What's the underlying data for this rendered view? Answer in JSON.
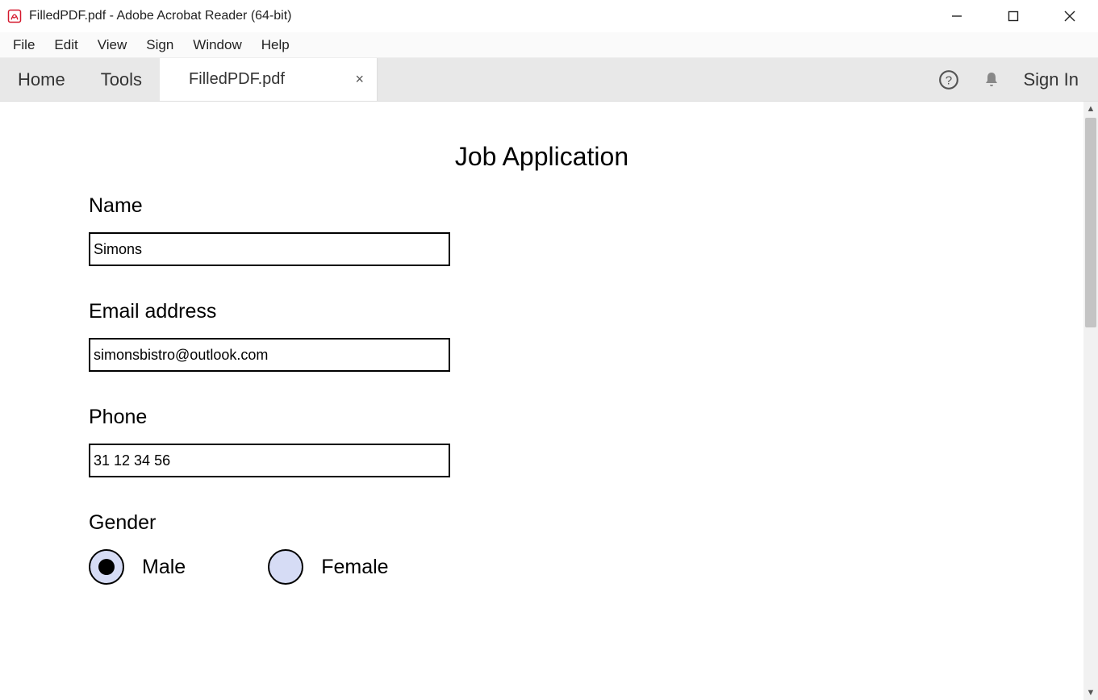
{
  "window": {
    "title": "FilledPDF.pdf - Adobe Acrobat Reader (64-bit)"
  },
  "menu": {
    "items": [
      "File",
      "Edit",
      "View",
      "Sign",
      "Window",
      "Help"
    ]
  },
  "tabs": {
    "home": "Home",
    "tools": "Tools",
    "document": "FilledPDF.pdf",
    "sign_in": "Sign In"
  },
  "form": {
    "title": "Job Application",
    "name_label": "Name",
    "name_value": "Simons",
    "email_label": "Email address",
    "email_value": "simonsbistro@outlook.com",
    "phone_label": "Phone",
    "phone_value": "31 12 34 56",
    "gender_label": "Gender",
    "gender_options": {
      "male": "Male",
      "female": "Female"
    },
    "gender_selected": "male"
  }
}
